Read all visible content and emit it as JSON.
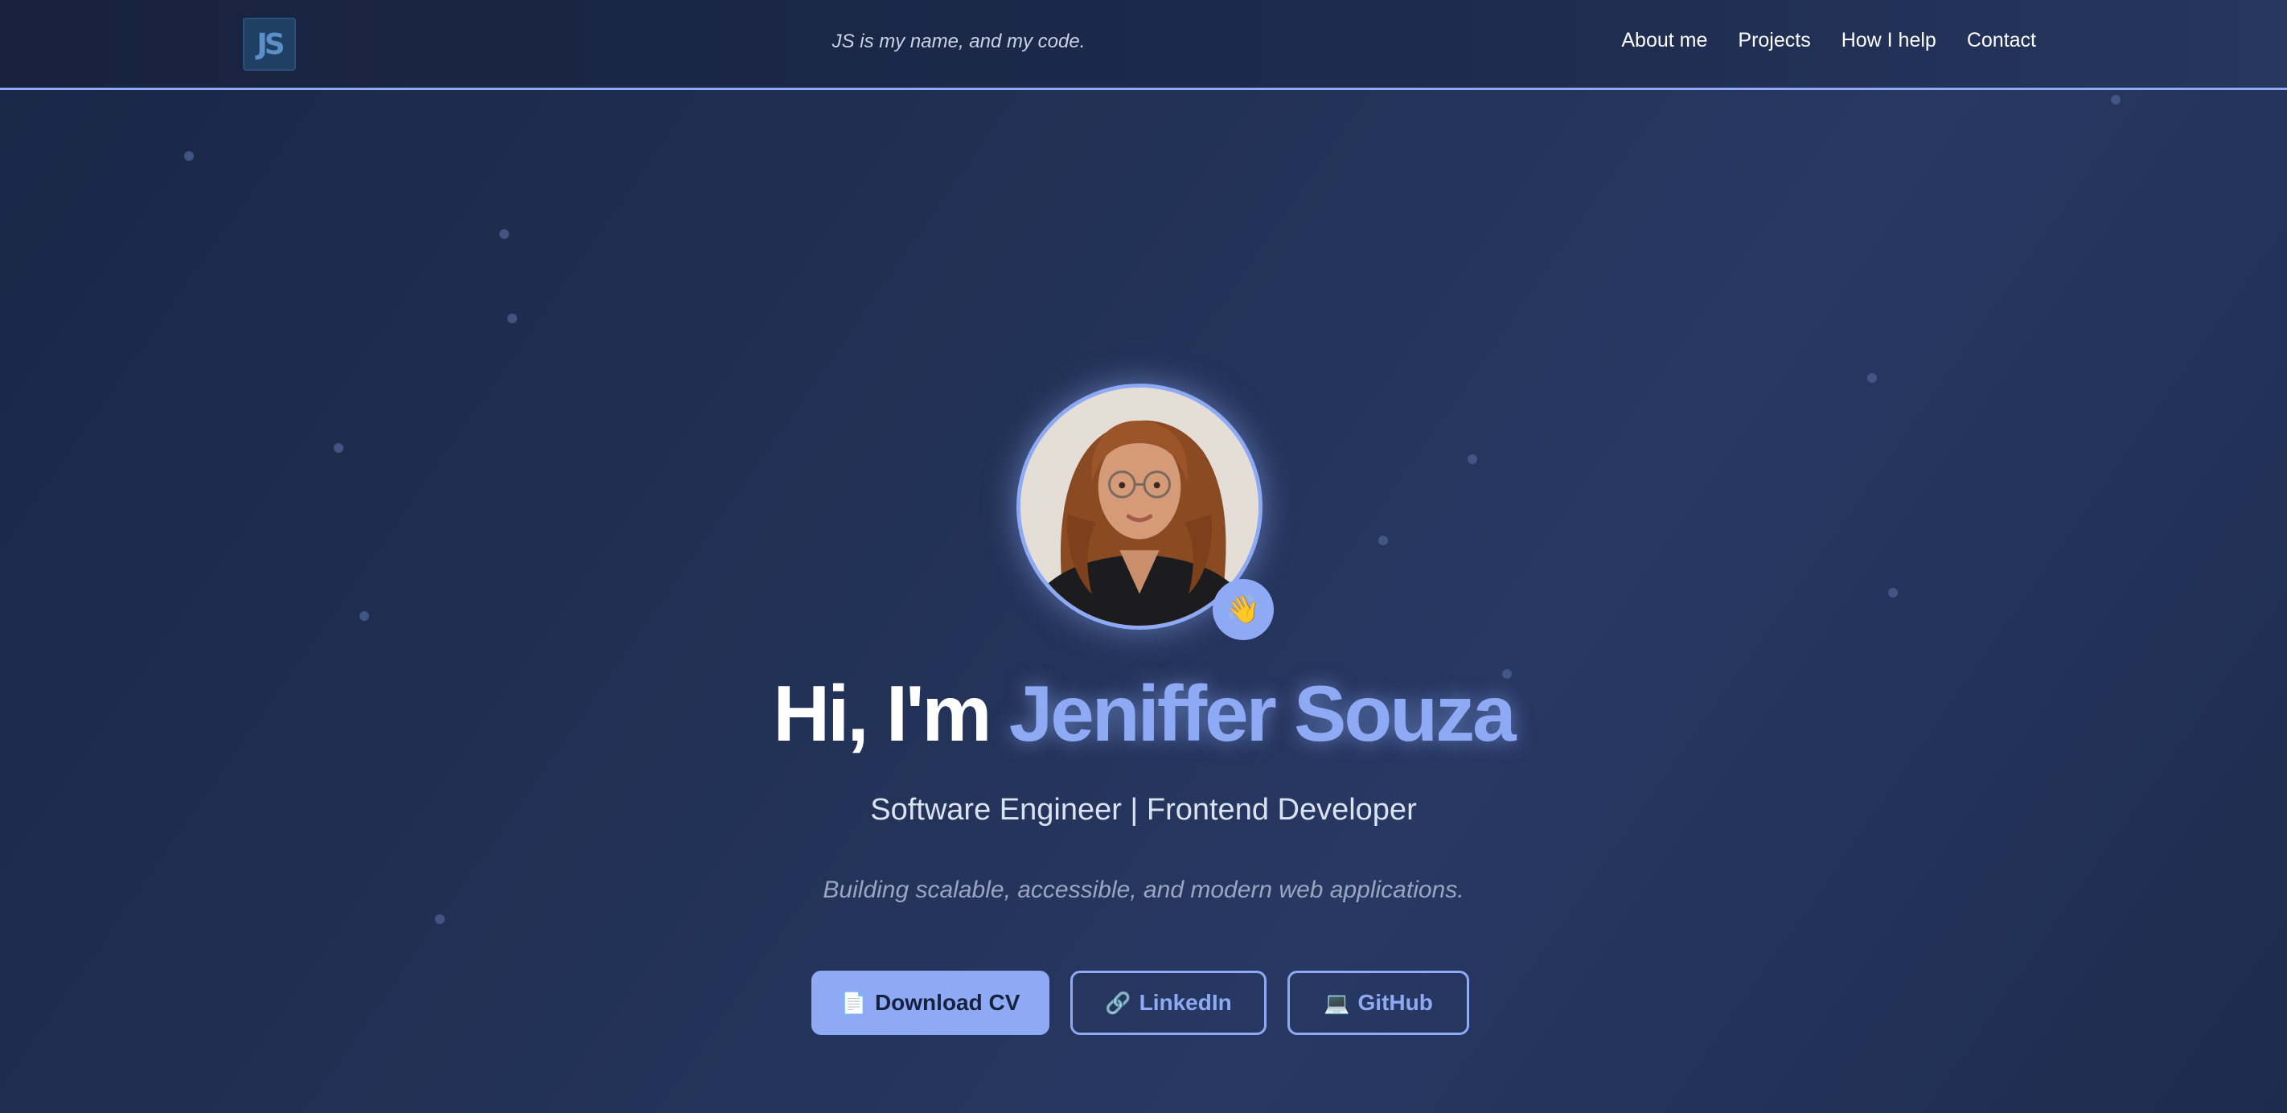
{
  "header": {
    "logo_text": "JS",
    "tagline": "JS is my name, and my code.",
    "nav": [
      "About me",
      "Projects",
      "How I help",
      "Contact"
    ]
  },
  "hero": {
    "greeting": "Hi, I'm",
    "name": "Jeniffer Souza",
    "role": "Software Engineer | Frontend Developer",
    "description": "Building scalable, accessible, and modern web applications.",
    "wave_emoji": "👋",
    "buttons": {
      "cv": {
        "icon": "📄",
        "label": "Download CV"
      },
      "linkedin": {
        "icon": "🔗",
        "label": "LinkedIn"
      },
      "github": {
        "icon": "💻",
        "label": "GitHub"
      }
    }
  },
  "colors": {
    "accent": "#8eaaf5",
    "background": "#233257",
    "header_bg": "#1b2745"
  }
}
